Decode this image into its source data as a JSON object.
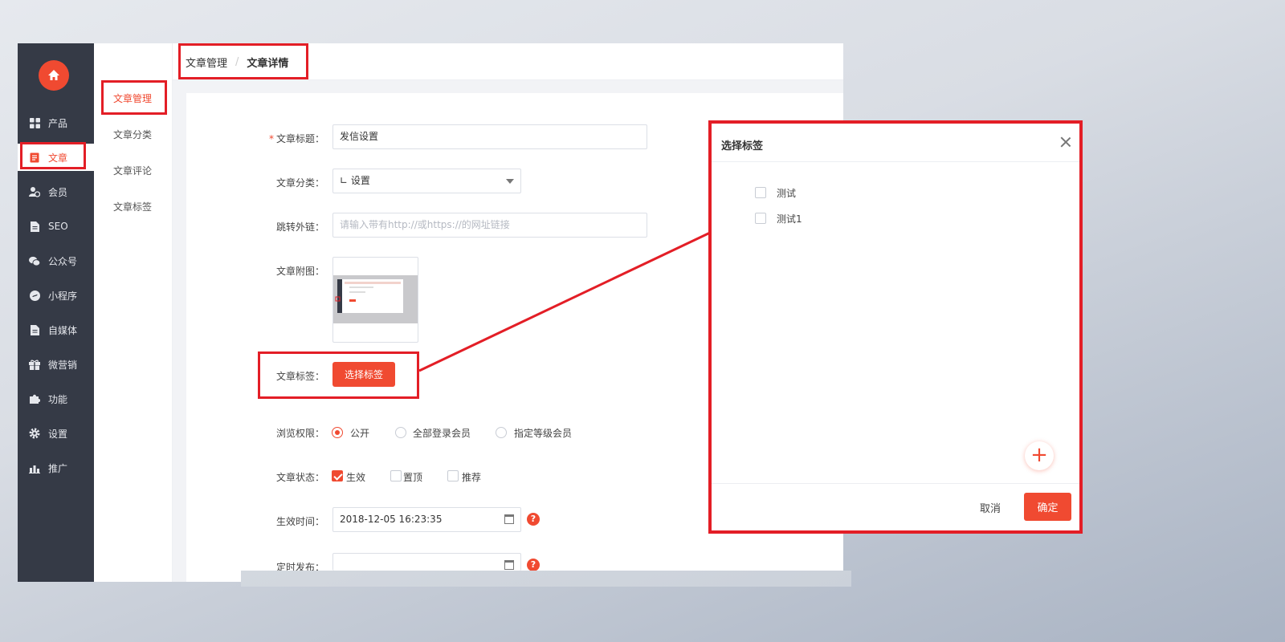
{
  "sidebar": {
    "items": [
      {
        "label": "产品",
        "icon": "grid-icon"
      },
      {
        "label": "文章",
        "icon": "document-icon",
        "active": true
      },
      {
        "label": "会员",
        "icon": "member-icon"
      },
      {
        "label": "SEO",
        "icon": "file-icon"
      },
      {
        "label": "公众号",
        "icon": "wechat-icon"
      },
      {
        "label": "小程序",
        "icon": "miniprogram-icon"
      },
      {
        "label": "自媒体",
        "icon": "media-icon"
      },
      {
        "label": "微营销",
        "icon": "gift-icon"
      },
      {
        "label": "功能",
        "icon": "puzzle-icon"
      },
      {
        "label": "设置",
        "icon": "gear-icon"
      },
      {
        "label": "推广",
        "icon": "chart-icon"
      }
    ]
  },
  "subnav": {
    "items": [
      "文章管理",
      "文章分类",
      "文章评论",
      "文章标签"
    ]
  },
  "breadcrumb": {
    "parent": "文章管理",
    "separator": "/",
    "current": "文章详情"
  },
  "form": {
    "title_label": "文章标题：",
    "title_value": "发信设置",
    "category_label": "文章分类：",
    "category_value": "∟ 设置",
    "link_label": "跳转外链：",
    "link_placeholder": "请输入带有http://或https://的网址链接",
    "image_label": "文章附图：",
    "tag_label": "文章标签：",
    "tag_button": "选择标签",
    "permission_label": "浏览权限：",
    "permission_options": [
      "公开",
      "全部登录会员",
      "指定等级会员"
    ],
    "status_label": "文章状态：",
    "status_options": [
      "生效",
      "置顶",
      "推荐"
    ],
    "effective_label": "生效时间：",
    "effective_value": "2018-12-05 16:23:35",
    "schedule_label": "定时发布：",
    "help_glyph": "?"
  },
  "dialog": {
    "title": "选择标签",
    "tags": [
      "测试",
      "测试1"
    ],
    "add_glyph": "+",
    "cancel": "取消",
    "confirm": "确定"
  },
  "colors": {
    "accent": "#f04a31",
    "sidebar_bg": "#353a46",
    "highlight": "#e31e26"
  }
}
